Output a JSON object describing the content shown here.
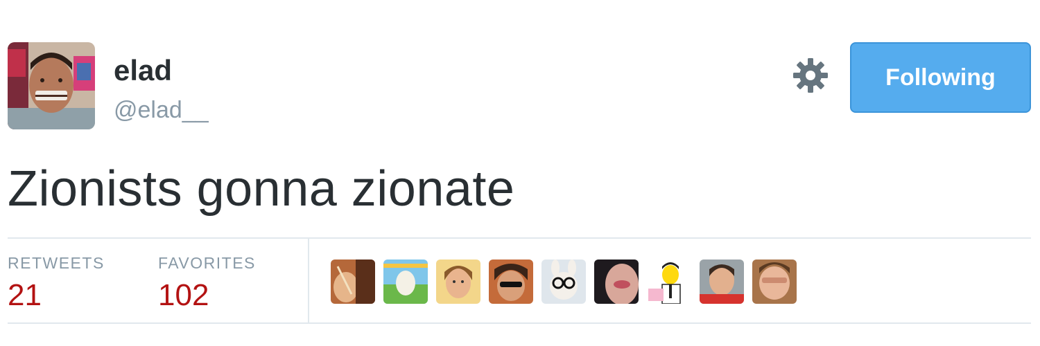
{
  "user": {
    "fullname": "elad",
    "username": "@elad__",
    "avatar": "profile-photo-man-smiling"
  },
  "actions": {
    "settings_icon": "gear-icon",
    "follow_label": "Following"
  },
  "tweet": {
    "text": "Zionists gonna zionate"
  },
  "stats": {
    "retweets_label": "RETWEETS",
    "retweets_count": "21",
    "favorites_label": "FAVORITES",
    "favorites_count": "102"
  },
  "favoriters": [
    {
      "name": "favoriter-1"
    },
    {
      "name": "favoriter-2"
    },
    {
      "name": "favoriter-3"
    },
    {
      "name": "favoriter-4"
    },
    {
      "name": "favoriter-5"
    },
    {
      "name": "favoriter-6"
    },
    {
      "name": "favoriter-7"
    },
    {
      "name": "favoriter-8"
    },
    {
      "name": "favoriter-9"
    }
  ],
  "colors": {
    "follow_button": "#55acee",
    "count_red": "#b31212",
    "text_dark": "#292f33",
    "text_muted": "#8899a6",
    "border": "#e1e8ed"
  }
}
